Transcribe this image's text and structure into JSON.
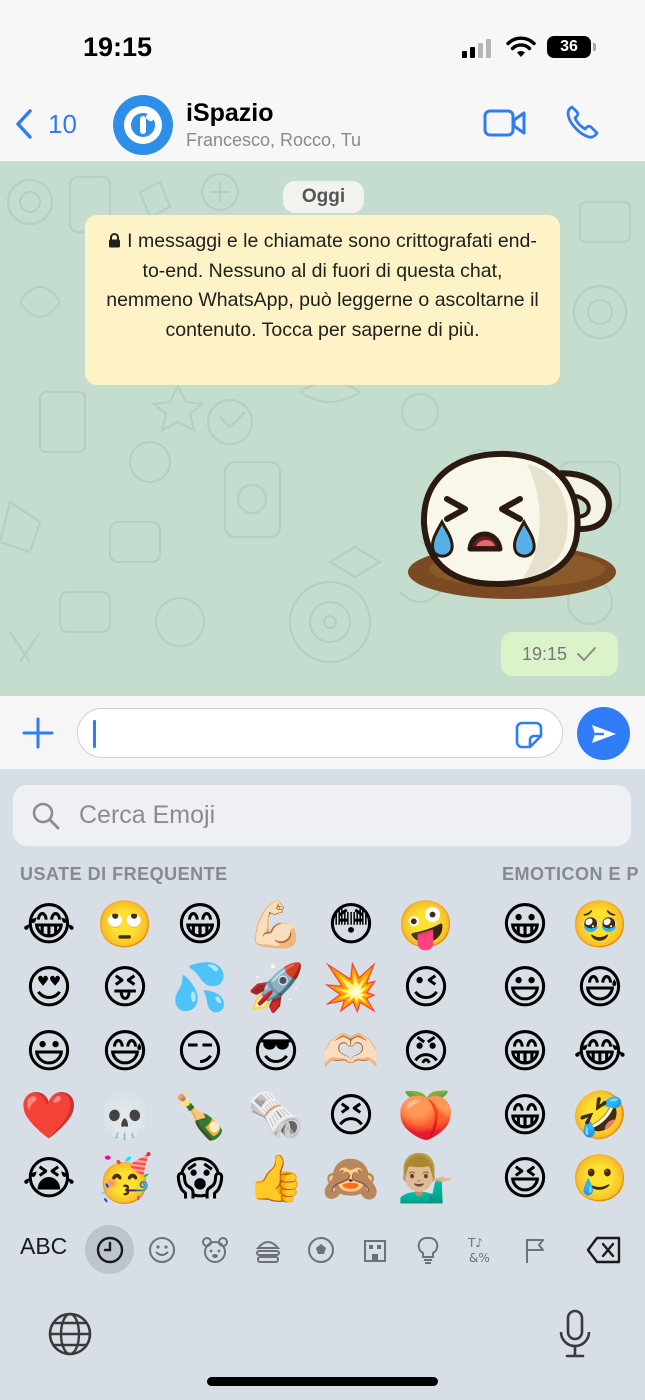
{
  "status_bar": {
    "time": "19:15",
    "battery": "36",
    "signal_bars": 2
  },
  "header": {
    "back_count": "10",
    "title": "iSpazio",
    "subtitle": "Francesco, Rocco, Tu",
    "accent_color": "#2f7cf6"
  },
  "chat": {
    "date_label": "Oggi",
    "notice": "I messaggi e le chiamate sono crittografati end-to-end. Nessuno al di fuori di questa chat, nemmeno WhatsApp, può leggerne o ascoltarne il contenuto. Tocca per saperne di più.",
    "message": {
      "time": "19:15",
      "status": "sent-check",
      "content_icon": "crying-cup-sticker"
    }
  },
  "input": {
    "value": "",
    "plus_icon": "plus-icon",
    "sticker_icon": "sticker-icon",
    "send_icon": "send-icon"
  },
  "keyboard": {
    "search_placeholder": "Cerca Emoji",
    "sections": [
      "USATE DI FREQUENTE",
      "EMOTICON E P"
    ],
    "frequent_rows": [
      [
        "😂",
        "🙄",
        "😁",
        "💪🏻",
        "😳",
        "🤪"
      ],
      [
        "😍",
        "😝",
        "💦",
        "🚀",
        "💥",
        "😉"
      ],
      [
        "😃",
        "😅",
        "😏",
        "😎",
        "🫶🏻",
        "😡"
      ],
      [
        "❤️",
        "💀",
        "🍾",
        "🗞️",
        "😣",
        "🍑"
      ],
      [
        "😭",
        "🥳",
        "😱",
        "👍",
        "🙈",
        "💁🏼‍♂️"
      ]
    ],
    "smileys_rows": [
      [
        "😀",
        "🥹"
      ],
      [
        "😃",
        "😅"
      ],
      [
        "😁",
        "😂"
      ],
      [
        "😁",
        "🤣"
      ],
      [
        "😆",
        "🥲"
      ]
    ],
    "abc_label": "ABC",
    "categories": [
      "recent-clock-icon",
      "smiley-icon",
      "animal-icon",
      "food-icon",
      "ball-icon",
      "building-icon",
      "lightbulb-icon",
      "symbols-icon",
      "flag-icon"
    ],
    "active_category": "recent-clock-icon"
  }
}
